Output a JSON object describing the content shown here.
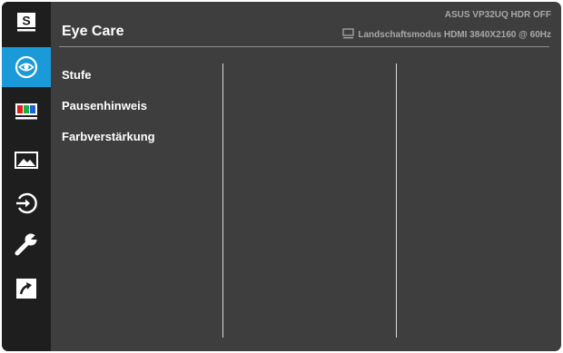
{
  "header": {
    "title": "Eye Care",
    "model_line": "ASUS  VP32UQ  HDR OFF",
    "status_line": "Landschaftsmodus HDMI 3840X2160 @ 60Hz",
    "status_icon": "monitor-icon"
  },
  "sidebar": {
    "items": [
      {
        "name": "splendid",
        "icon": "splendid-s-icon",
        "glyph": "S",
        "active": false
      },
      {
        "name": "eye-care",
        "icon": "eye-icon",
        "active": true
      },
      {
        "name": "color",
        "icon": "color-bars-icon",
        "active": false
      },
      {
        "name": "image",
        "icon": "image-icon",
        "active": false
      },
      {
        "name": "input-select",
        "icon": "input-select-icon",
        "active": false
      },
      {
        "name": "system-setup",
        "icon": "wrench-icon",
        "active": false
      },
      {
        "name": "shortcut",
        "icon": "shortcut-arrow-icon",
        "active": false
      }
    ]
  },
  "menu": {
    "items": [
      {
        "label": "Stufe"
      },
      {
        "label": "Pausenhinweis"
      },
      {
        "label": "Farbverstärkung"
      }
    ]
  },
  "colors": {
    "background": "#3e3e3e",
    "sidebar": "#1e1e1e",
    "accent": "#1a9ad8",
    "text": "#ffffff",
    "muted_text": "#a8a8a8"
  }
}
